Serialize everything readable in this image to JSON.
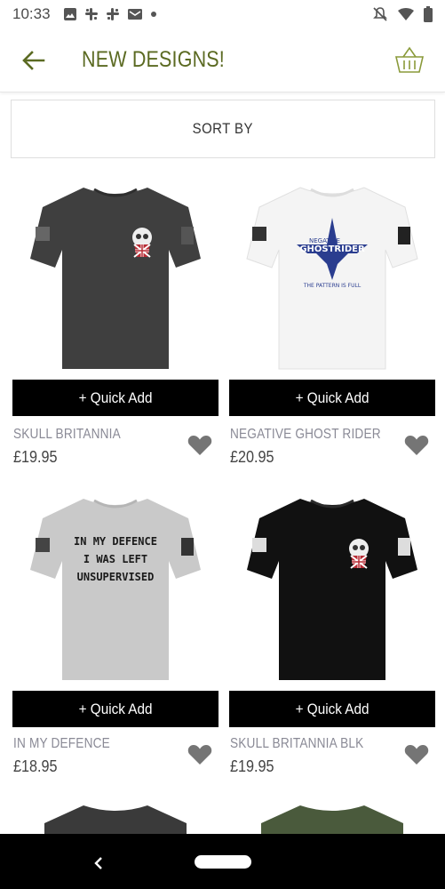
{
  "status_bar": {
    "time": "10:33",
    "left_icons": [
      "image-icon",
      "slack-icon",
      "slack-icon",
      "mail-icon",
      "dot-icon"
    ],
    "right_icons": [
      "notifications-off-icon",
      "wifi-icon",
      "battery-icon"
    ]
  },
  "app_bar": {
    "title": "NEW DESIGNS!",
    "back_icon": "arrow-back-icon",
    "basket_icon": "basket-icon"
  },
  "sort": {
    "label": "SORT BY"
  },
  "products": [
    {
      "name": "SKULL BRITANNIA",
      "price": "£19.95",
      "quick_add": "+ Quick Add",
      "shirt_color": "#3f3f3f",
      "design": "skull",
      "favorite_icon": "heart-icon"
    },
    {
      "name": "NEGATIVE GHOST RIDER",
      "price": "£20.95",
      "quick_add": "+ Quick Add",
      "shirt_color": "#f4f4f4",
      "design": "ghostrider",
      "design_text_1": "NEGATIVE",
      "design_text_2": "GHOSTRIDER",
      "design_text_3": "THE PATTERN IS FULL",
      "favorite_icon": "heart-icon"
    },
    {
      "name": "IN MY DEFENCE",
      "price": "£18.95",
      "quick_add": "+ Quick Add",
      "shirt_color": "#c9c9c9",
      "design": "text",
      "design_text_1": "IN MY DEFENCE",
      "design_text_2": "I WAS LEFT",
      "design_text_3": "UNSUPERVISED",
      "favorite_icon": "heart-icon"
    },
    {
      "name": "SKULL BRITANNIA BLK",
      "price": "£19.95",
      "quick_add": "+ Quick Add",
      "shirt_color": "#111111",
      "design": "skull",
      "favorite_icon": "heart-icon"
    }
  ],
  "partial_products": [
    {
      "shirt_color": "#3a3a3a"
    },
    {
      "shirt_color": "#4a5a3c"
    }
  ],
  "colors": {
    "brand_title": "#5b6a22",
    "button_bg": "#000000",
    "heart": "#757575"
  },
  "nav_bar": {
    "back_icon": "nav-back-icon",
    "home_icon": "home-pill-icon"
  }
}
